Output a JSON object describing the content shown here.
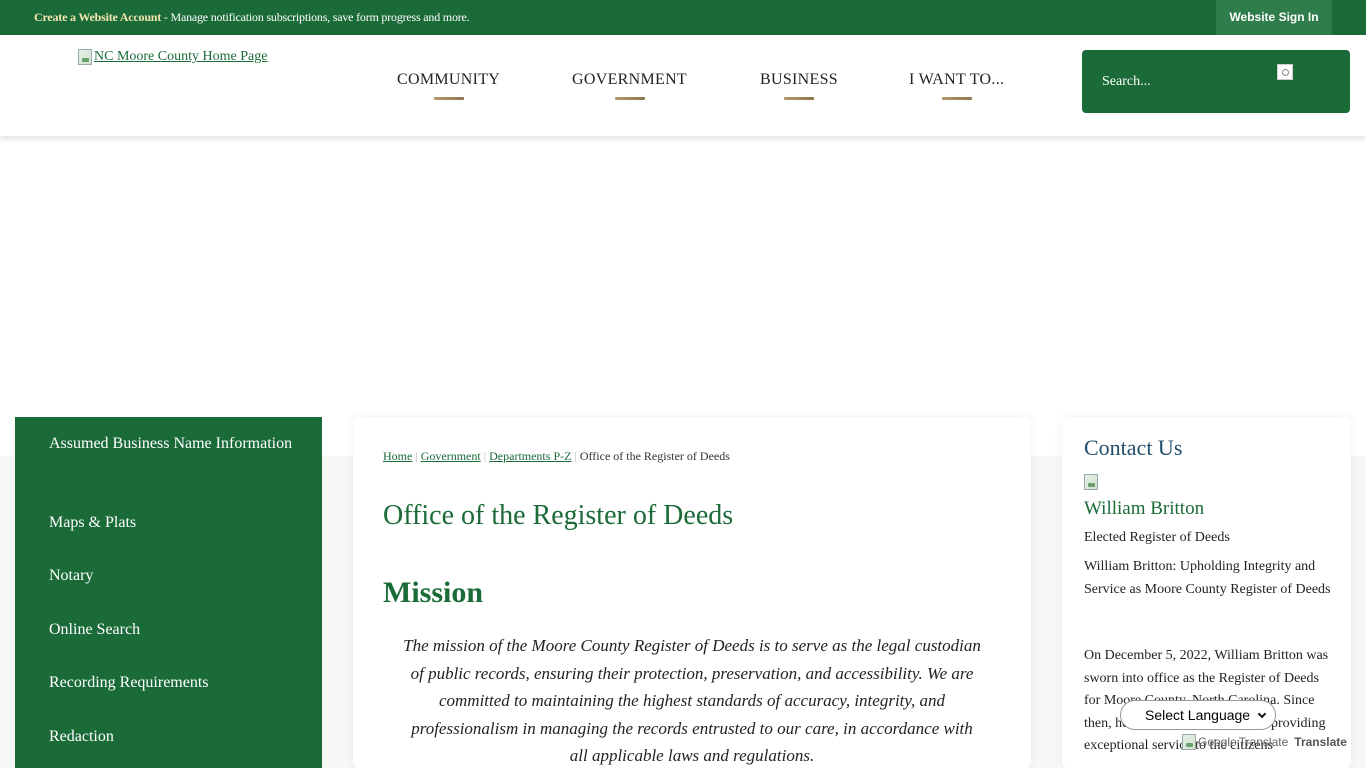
{
  "topbar": {
    "create_account": "Create a Website Account",
    "message": " - Manage notification subscriptions, save form progress and more.",
    "sign_in": "Website Sign In"
  },
  "header": {
    "logo_alt": "NC Moore County Home Page",
    "nav": [
      "COMMUNITY",
      "GOVERNMENT",
      "BUSINESS",
      "I WANT TO..."
    ],
    "search_placeholder": "Search..."
  },
  "sidebar": {
    "items": [
      "Assumed Business Name Information",
      "Maps & Plats",
      "Notary",
      "Online Search",
      "Recording Requirements",
      "Redaction"
    ]
  },
  "breadcrumb": {
    "home": "Home",
    "government": "Government",
    "departments": "Departments P-Z",
    "current": "Office of the Register of Deeds",
    "separator": "|"
  },
  "main": {
    "title": "Office of the Register of Deeds",
    "mission_heading": "Mission",
    "mission_text": "The mission of the Moore County Register of Deeds is to serve as the legal custodian of public records, ensuring their protection, preservation, and accessibility. We are committed to maintaining the highest standards of accuracy, integrity, and professionalism in managing the records entrusted to our care, in accordance with all applicable laws and regulations."
  },
  "contact": {
    "title": "Contact Us",
    "name": "William Britton",
    "role": "Elected Register of Deeds",
    "headline": "William Britton: Upholding Integrity and Service as Moore County Register of Deeds",
    "body": "On December 5, 2022, William Britton was sworn into office as the Register of Deeds for Moore County, North Carolina. Since then, he has dedicated himself to providing exceptional service to the citizens"
  },
  "translate": {
    "select_label": "Select Language",
    "google_alt": "Google",
    "translate_label": "Translate"
  },
  "colors": {
    "brand_green": "#1a6b38",
    "accent_gold": "#b39a6a",
    "contact_blue": "#1f4d6b"
  }
}
